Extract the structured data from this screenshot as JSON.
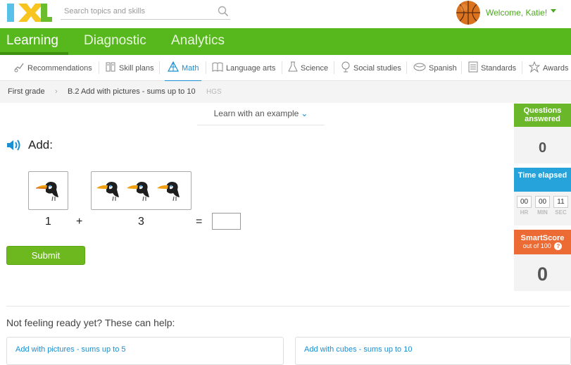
{
  "logo": {
    "text": "IXL"
  },
  "search": {
    "placeholder": "Search topics and skills"
  },
  "user": {
    "welcome": "Welcome, Katie!"
  },
  "main_nav": [
    {
      "label": "Learning",
      "active": true
    },
    {
      "label": "Diagnostic",
      "active": false
    },
    {
      "label": "Analytics",
      "active": false
    }
  ],
  "subject_nav": [
    {
      "label": "Recommendations",
      "icon": "recommendations-icon"
    },
    {
      "label": "Skill plans",
      "icon": "skill-plans-icon"
    },
    {
      "label": "Math",
      "icon": "math-icon",
      "active": true
    },
    {
      "label": "Language arts",
      "icon": "language-arts-icon"
    },
    {
      "label": "Science",
      "icon": "science-icon"
    },
    {
      "label": "Social studies",
      "icon": "social-studies-icon"
    },
    {
      "label": "Spanish",
      "icon": "spanish-icon"
    },
    {
      "label": "Standards",
      "icon": "standards-icon"
    },
    {
      "label": "Awards",
      "icon": "awards-icon"
    }
  ],
  "breadcrumb": {
    "grade": "First grade",
    "skill": "B.2 Add with pictures - sums up to 10",
    "code": "HGS"
  },
  "learn_example": "Learn with an example",
  "question": {
    "prompt": "Add:",
    "left_count": 1,
    "right_count": 3,
    "left_number": "1",
    "plus": "+",
    "right_number": "3",
    "equals": "=",
    "answer_value": ""
  },
  "submit_label": "Submit",
  "sidebar": {
    "questions_label": "Questions answered",
    "questions_value": "0",
    "time_label": "Time elapsed",
    "time": {
      "hr": "00",
      "min": "00",
      "sec": "11",
      "hr_label": "HR",
      "min_label": "MIN",
      "sec_label": "SEC"
    },
    "smartscore_label": "SmartScore",
    "smartscore_sub": "out of 100",
    "smartscore_value": "0"
  },
  "help": {
    "heading": "Not feeling ready yet? These can help:",
    "links": [
      "Add with pictures - sums up to 5",
      "Add with cubes - sums up to 10"
    ]
  },
  "colors": {
    "brand_green": "#56b81d",
    "link_blue": "#1a8fd1",
    "questions_green": "#6ab82a",
    "time_blue": "#27a3db",
    "smartscore_orange": "#ec6a33"
  }
}
